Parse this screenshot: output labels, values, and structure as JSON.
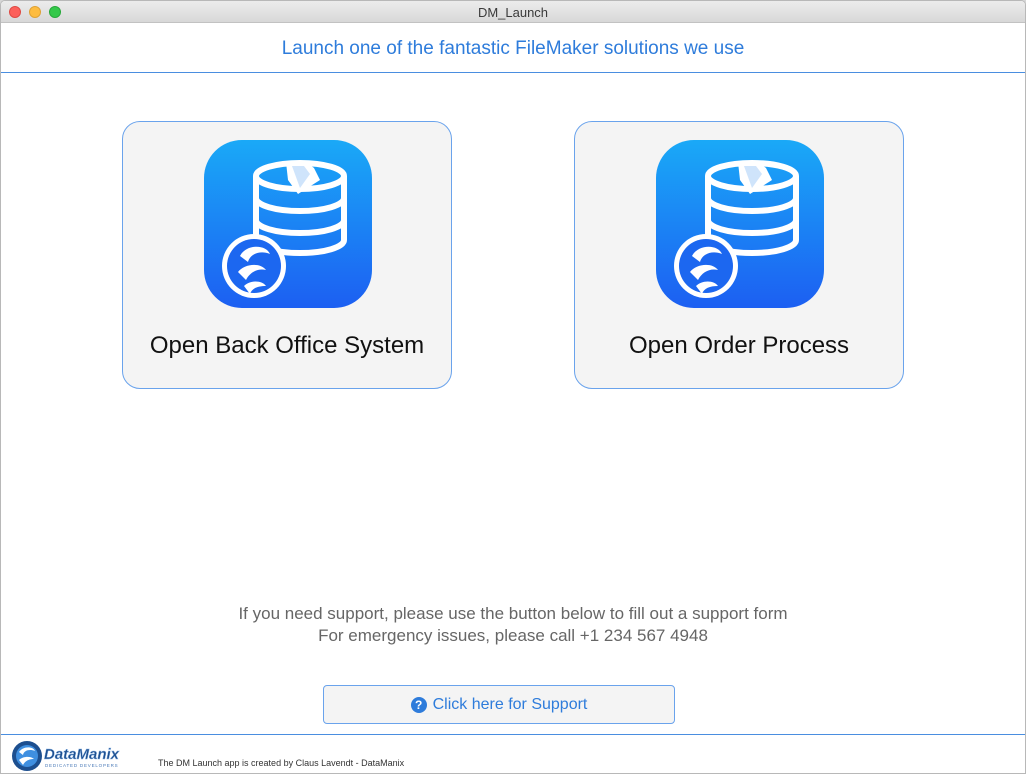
{
  "window": {
    "title": "DM_Launch"
  },
  "header": {
    "text": "Launch one of the fantastic FileMaker solutions we use"
  },
  "buttons": [
    {
      "label": "Open Back Office System",
      "icon": "filemaker-database-icon"
    },
    {
      "label": "Open Order Process",
      "icon": "filemaker-database-icon"
    }
  ],
  "support": {
    "line1": "If you need support, please use the button below to fill out a support form",
    "line2": "For emergency issues, please call +1 234 567 4948",
    "button_label": "Click here for Support",
    "button_icon": "?"
  },
  "footer": {
    "logo_text": "DataManix",
    "logo_tagline": "DEDICATED DEVELOPERS",
    "credit": "The DM Launch app is created by Claus Lavendt - DataManix"
  },
  "colors": {
    "accent": "#2e7cdb",
    "border": "#6aa3ec",
    "icon_top": "#1aa9f7",
    "icon_bottom": "#1c5ff2"
  }
}
